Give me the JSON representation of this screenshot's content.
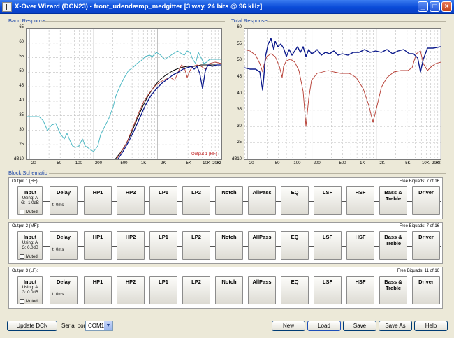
{
  "window": {
    "title": "X-Over Wizard (DCN23) - front_udendæmp_medgitter [3 way, 24 bits @ 96 kHz]",
    "minimize_icon": "minimize-icon",
    "maximize_icon": "maximize-icon",
    "close_icon": "close-icon",
    "app_icon": "app-icon"
  },
  "band_response": {
    "title": "Band Response",
    "y_ticks": [
      "65",
      "60",
      "55",
      "50",
      "45",
      "40",
      "35",
      "30",
      "25",
      "dB10"
    ],
    "x_ticks": [
      "20",
      "50",
      "100",
      "200",
      "500",
      "1K",
      "2K",
      "5K",
      "10K",
      "20K",
      "Hz"
    ],
    "note": "Output 1 (HF)"
  },
  "total_response": {
    "title": "Total Response",
    "y_ticks": [
      "60",
      "55",
      "50",
      "45",
      "40",
      "35",
      "30",
      "25",
      "dB10"
    ],
    "x_ticks": [
      "20",
      "50",
      "100",
      "200",
      "500",
      "1K",
      "2K",
      "5K",
      "10K",
      "20K",
      "Hz"
    ]
  },
  "colors": {
    "cyan": "#4fb9c4",
    "navy": "#0c1a8c",
    "red": "#b53a30",
    "black": "#000000"
  },
  "schematic": {
    "title": "Block Schematic",
    "blocks": [
      "Delay",
      "HP1",
      "HP2",
      "LP1",
      "LP2",
      "Notch",
      "AllPass",
      "EQ",
      "LSF",
      "HSF",
      "Bass &\nTreble",
      "Driver"
    ],
    "delay_value": "t: 0ms",
    "input_label": "Input",
    "using": "Using: A",
    "muted_label": "Muted",
    "outputs": [
      {
        "name": "Output 1 (HF):",
        "biquads": "Free Biquads: 7 of 16",
        "gain": "G: -1.0dB"
      },
      {
        "name": "Output 2 (MF):",
        "biquads": "Free Biquads: 7 of 16",
        "gain": "G: 0.0dB"
      },
      {
        "name": "Output 3 (LF):",
        "biquads": "Free Biquads: 11 of 16",
        "gain": "G: 0.0dB"
      }
    ]
  },
  "bottom": {
    "update_label": "Update DCN",
    "serial_label": "Serial port",
    "serial_value": "COM1",
    "new_label": "New",
    "load_label": "Load",
    "save_label": "Save",
    "saveas_label": "Save As",
    "help_label": "Help"
  }
}
